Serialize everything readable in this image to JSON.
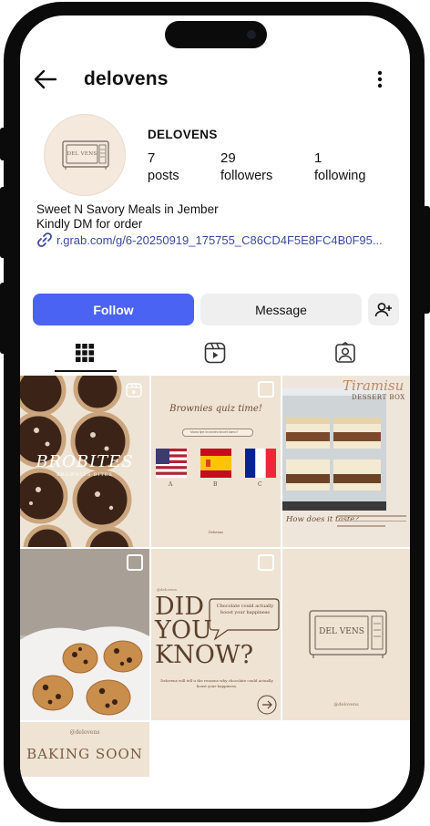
{
  "profile": {
    "username": "delovens",
    "display_name": "DELOVENS",
    "logo_text": "DEL   VENS",
    "stats": [
      {
        "value": "7",
        "label": "posts"
      },
      {
        "value": "29",
        "label": "followers"
      },
      {
        "value": "1",
        "label": "following"
      }
    ],
    "bio_lines": [
      "Sweet N Savory Meals in Jember",
      "Kindly DM for order"
    ],
    "link": "r.grab.com/g/6-20250919_175755_C86CD4F5E8FC4B0F95..."
  },
  "actions": {
    "follow": "Follow",
    "message": "Message"
  },
  "tabs": [
    "grid-tab",
    "reels-tab",
    "tagged-tab"
  ],
  "posts": {
    "p1": {
      "title": "BROBITES",
      "subtitle": "BROWNIES BITES"
    },
    "p2": {
      "title": "Brownies quiz time!",
      "search": "Mana tipe brownies favorit kamu?",
      "options": [
        "A",
        "B",
        "C"
      ],
      "footer": "Delovens"
    },
    "p3": {
      "title": "Tiramisu",
      "subtitle": "DESSERT BOX",
      "caption": "How does it taste?"
    },
    "p5": {
      "handle": "@delovens",
      "big1": "DID",
      "big2": "YOU",
      "big3": "KNOW?",
      "bubble": "Chocolate could actually boost your happiness",
      "body": "Delovens will tell u the reasons why chocolate could actually boost your happiness."
    },
    "p6": {
      "handle": "@delovens"
    },
    "p7": {
      "handle": "@delovens",
      "title": "BAKING SOON"
    }
  },
  "colors": {
    "accent": "#4a63f2",
    "cream": "#efe3d3",
    "brown": "#6b4a33"
  }
}
